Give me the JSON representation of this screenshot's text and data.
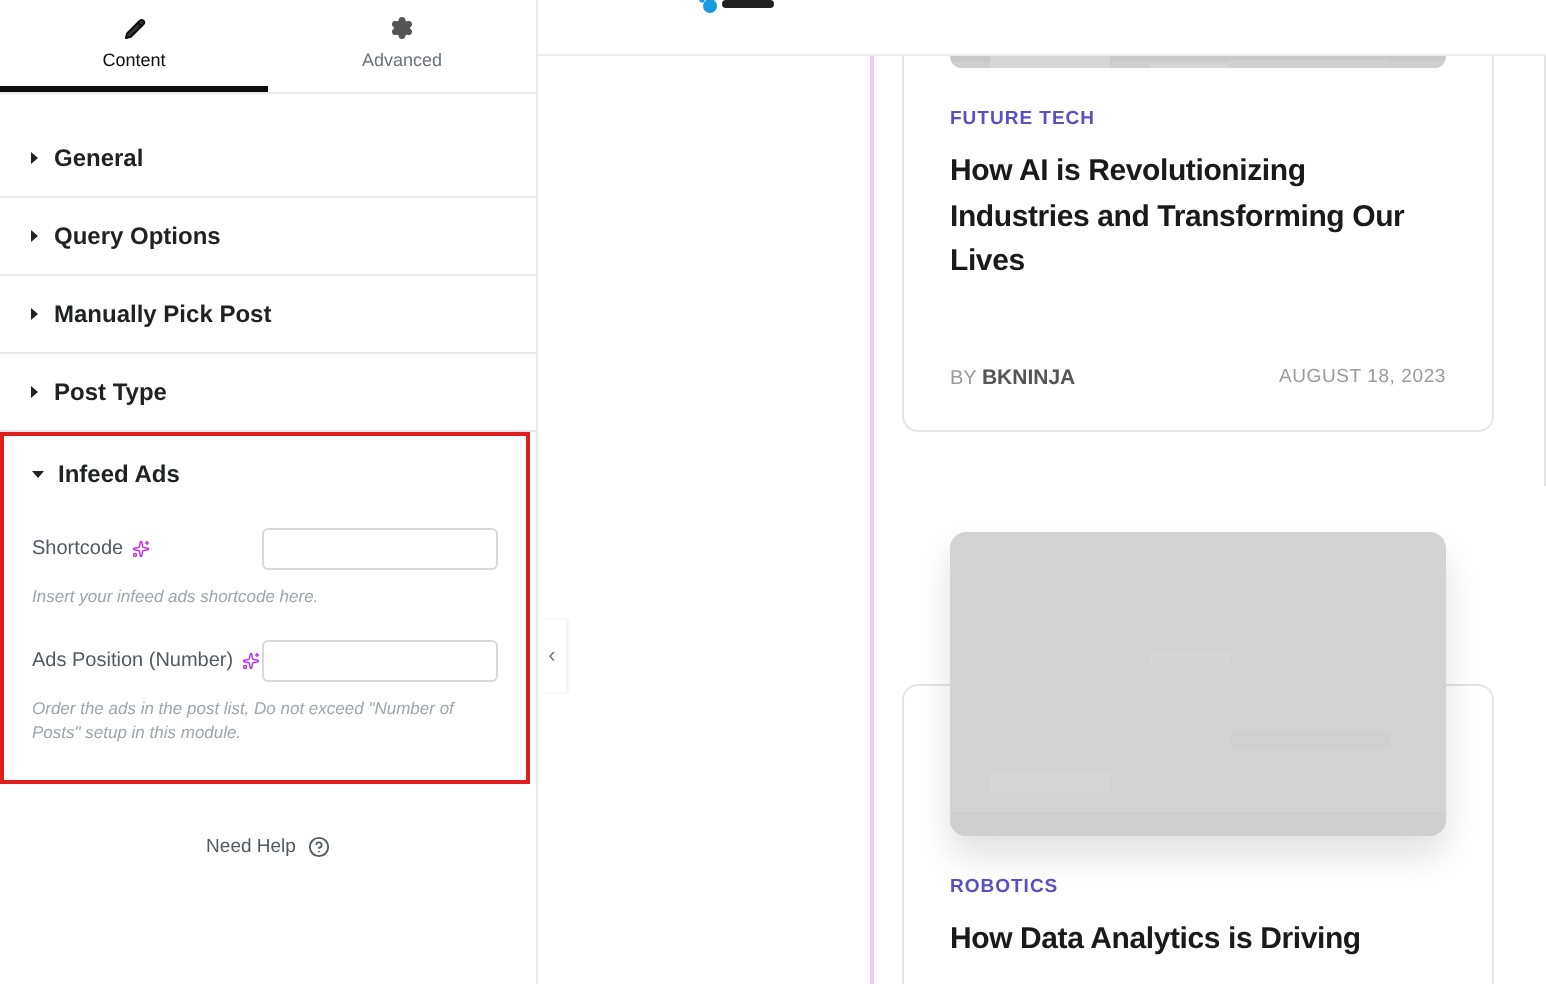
{
  "tabs": [
    {
      "label": "Content",
      "selected": true
    },
    {
      "label": "Advanced",
      "selected": false
    }
  ],
  "sections": [
    {
      "title": "General",
      "expanded": false
    },
    {
      "title": "Query Options",
      "expanded": false
    },
    {
      "title": "Manually Pick Post",
      "expanded": false
    },
    {
      "title": "Post Type",
      "expanded": false
    },
    {
      "title": "Infeed Ads",
      "expanded": true,
      "highlighted": true,
      "fields": [
        {
          "label": "Shortcode",
          "hint": "Insert your infeed ads shortcode here."
        },
        {
          "label": "Ads Position (Number)",
          "hint": "Order the ads in the post list, Do not exceed \"Number of Posts\" setup in this module."
        }
      ]
    }
  ],
  "help": {
    "label": "Need Help"
  },
  "collapse": {
    "glyph": "‹"
  },
  "posts": [
    {
      "category": "FUTURE TECH",
      "title": "How AI is Revolutionizing Industries and Transforming Our Lives",
      "author_prefix": "BY",
      "author": "BKNINJA",
      "date": "AUGUST 18, 2023"
    },
    {
      "category": "ROBOTICS",
      "title": "How Data Analytics is Driving"
    }
  ]
}
